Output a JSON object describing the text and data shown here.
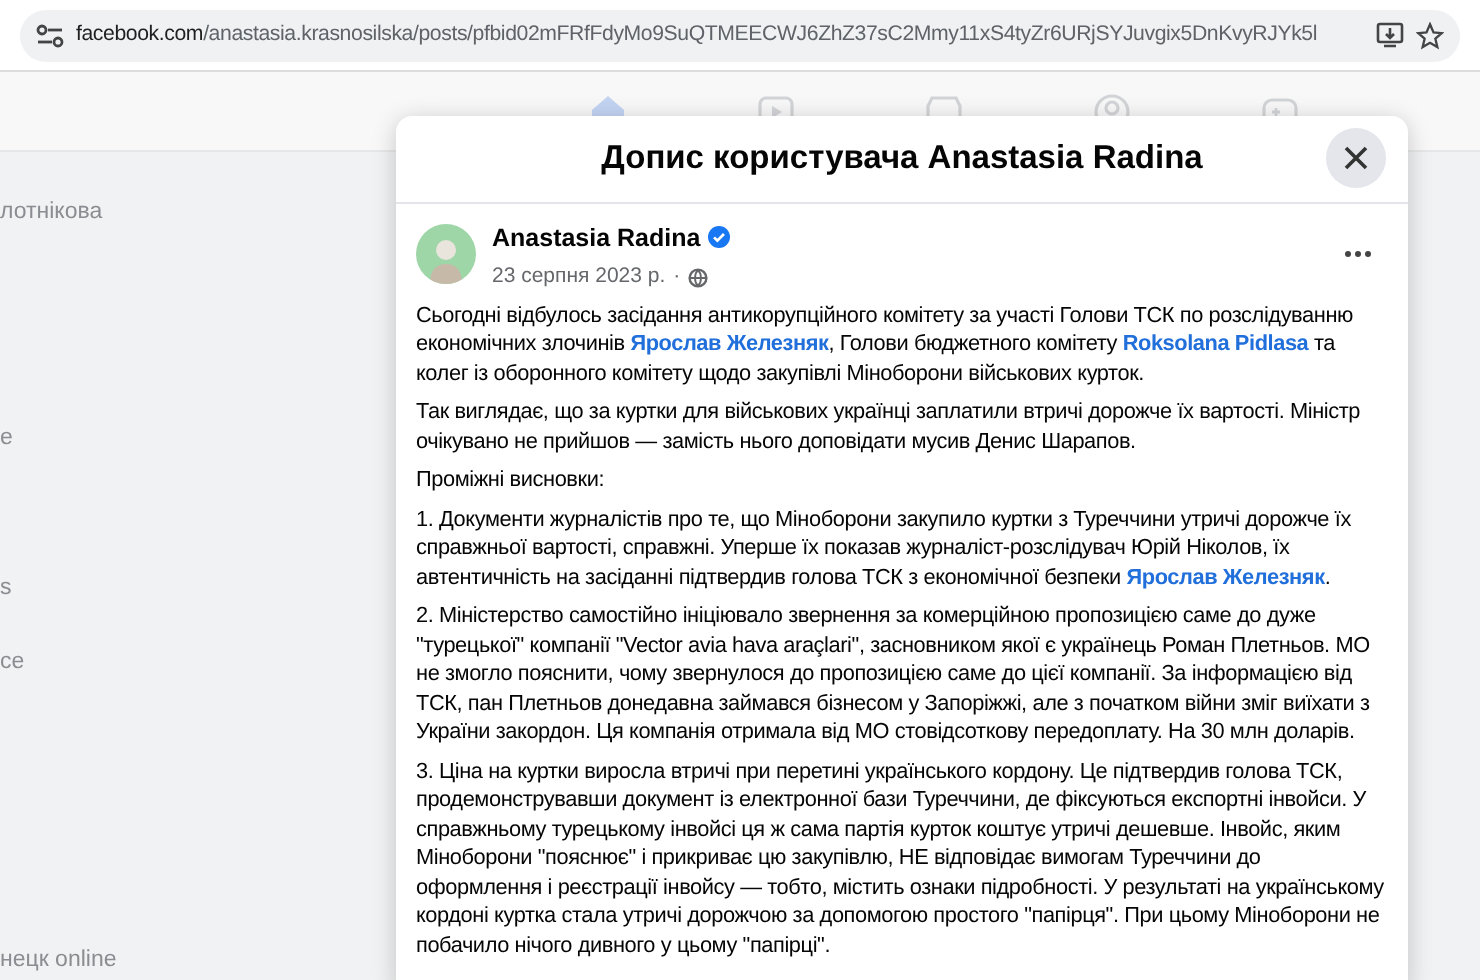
{
  "browser": {
    "url_domain": "facebook.com",
    "url_path": "/anastasia.krasnosilska/posts/pfbid02mFRfFdyMo9SuQTMEECWJ6ZhZ37sC2Mmy11xS4tyZr6URjSYJuvgix5DnKvyRJYk5l"
  },
  "sidebar": {
    "items": [
      "лотнікова",
      "е",
      "s",
      "ce",
      "нецк online"
    ]
  },
  "modal": {
    "title": "Допис користувача Anastasia Radina",
    "post": {
      "author": "Anastasia Radina",
      "verified": true,
      "date": "23 серпня 2023 р.",
      "separator": "·",
      "paragraphs": [
        [
          {
            "kind": "text",
            "text": "Сьогодні відбулось засідання антикорупційного комітету за участі Голови ТСК по розслідуванню економічних злочинів "
          },
          {
            "kind": "link",
            "text": "Ярослав Железняк"
          },
          {
            "kind": "text",
            "text": ", Голови бюджетного комітету "
          },
          {
            "kind": "link",
            "text": "Roksolana Pidlasa"
          },
          {
            "kind": "text",
            "text": " та колег із оборонного комітету щодо закупівлі Міноборони військових курток."
          }
        ],
        [
          {
            "kind": "text",
            "text": "Так виглядає, що за куртки для військових українці заплатили втричі дорожче їх вартості. Міністр очікувано не прийшов — замість нього доповідати мусив Денис Шарапов."
          }
        ],
        [
          {
            "kind": "text",
            "text": "Проміжні висновки:"
          }
        ],
        [
          {
            "kind": "text",
            "text": "1. Документи журналістів про те, що Міноборони закупило куртки з Туреччини утричі дорожче їх справжньої вартості, справжні. Уперше їх показав журналіст-розслідувач Юрій Ніколов, їх автентичність на засіданні підтвердив голова ТСК з економічної безпеки "
          },
          {
            "kind": "link",
            "text": "Ярослав Железняк"
          },
          {
            "kind": "text",
            "text": "."
          }
        ],
        [
          {
            "kind": "text",
            "text": "2. Міністерство самостійно ініціювало звернення за комерційною пропозицією саме до дуже \"турецької\" компанії \"Vector avia hava araçlari\", засновником якої є українець Роман Плетньов. МО не змогло пояснити, чому звернулося до пропозицією саме до цієї компанії. За інформацією від ТСК, пан Плетньов донедавна займався бізнесом у Запоріжжі, але з початком війни зміг виїхати з України закордон. Ця компанія отримала від МО стовідсоткову передоплату. На 30 млн доларів."
          }
        ],
        [
          {
            "kind": "text",
            "text": "3. Ціна на куртки виросла втричі при перетині українського кордону. Це підтвердив голова ТСК, продемонструвавши документ із електронної бази Туреччини, де фіксуються експортні інвойси. У справжньому турецькому інвойсі ця ж сама партія курток коштує утричі дешевше. Інвойс, яким Міноборони \"пояснює\" і прикриває цю закупівлю, НЕ відповідає вимогам Туреччини до оформлення і реєстрації інвойсу — тобто, містить ознаки підробності. У результаті на українському кордоні куртка стала утричі дорожчою за допомогою простого \"папірця\". При цьому Міноборони не побачило нічого дивного у цьому \"папірці\"."
          }
        ]
      ]
    }
  }
}
